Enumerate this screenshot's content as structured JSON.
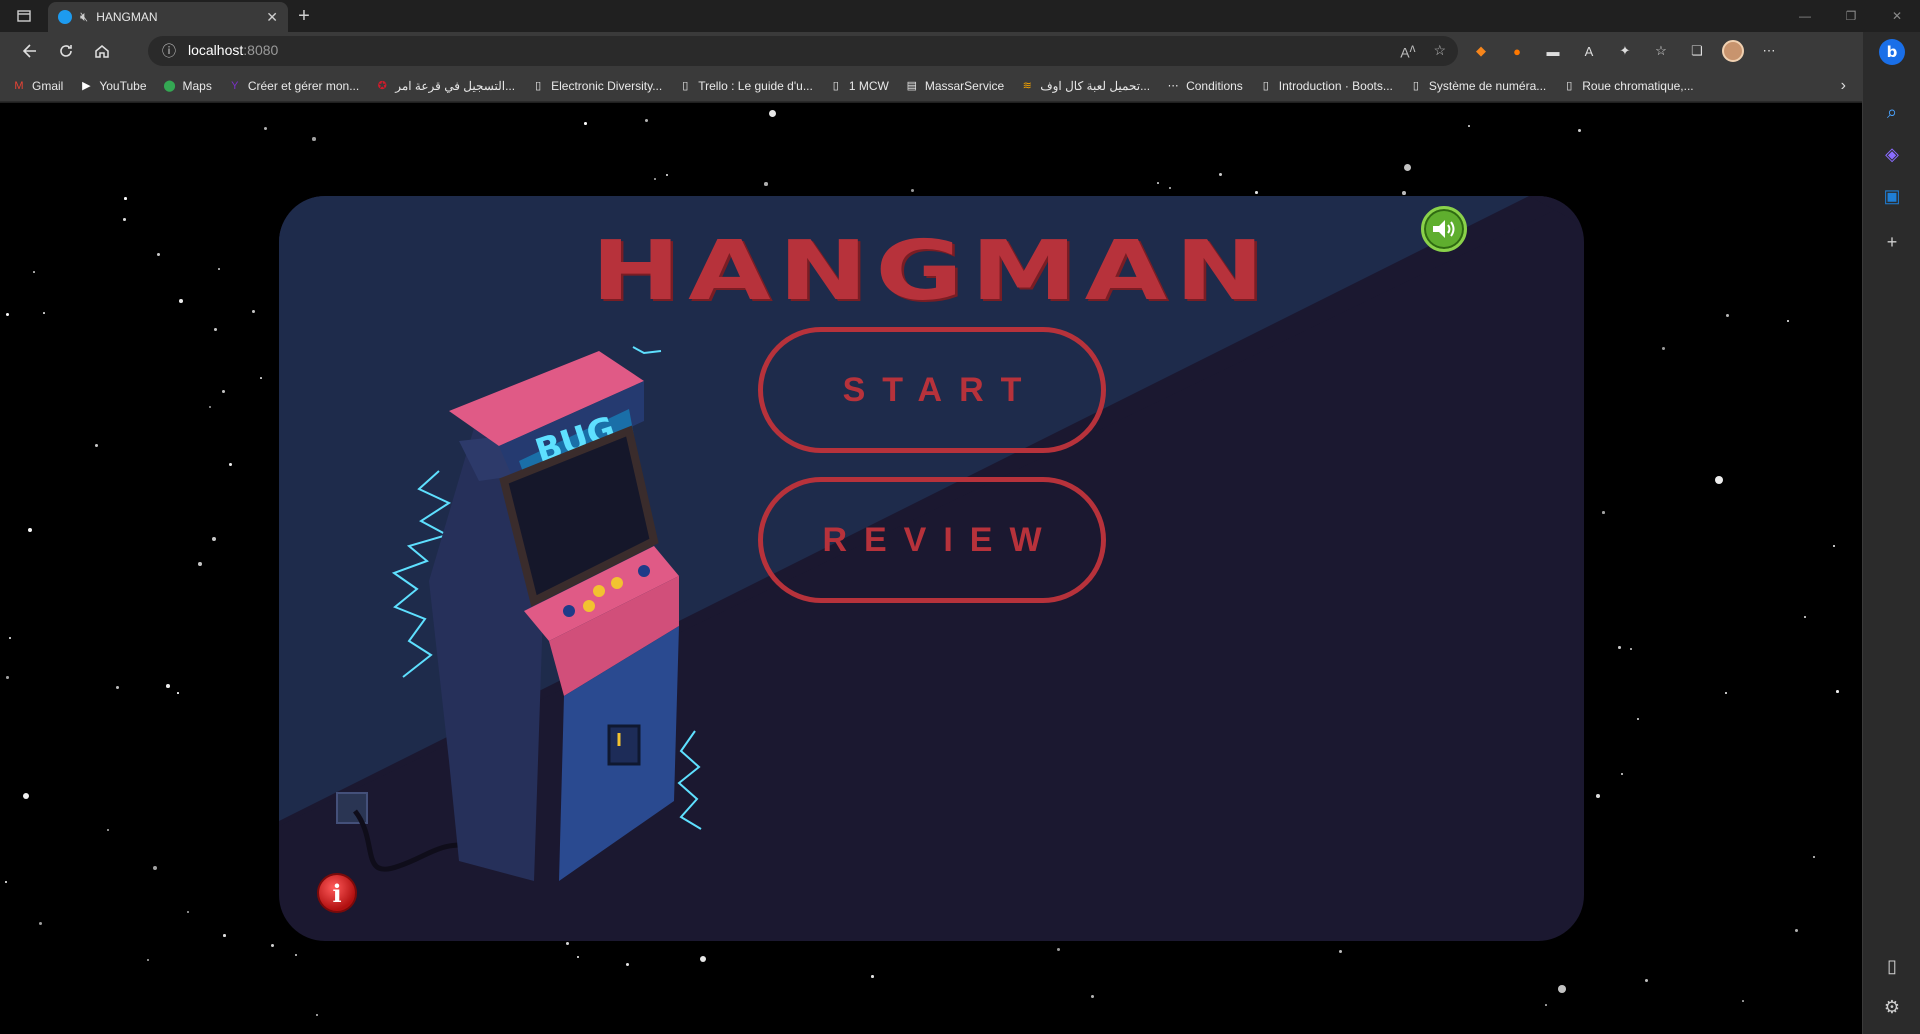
{
  "browser": {
    "tab": {
      "title": "HANGMAN"
    },
    "address": {
      "host": "localhost",
      "port": ":8080"
    },
    "bookmarks": [
      {
        "label": "Gmail",
        "icon": "gmail-icon"
      },
      {
        "label": "YouTube",
        "icon": "youtube-icon"
      },
      {
        "label": "Maps",
        "icon": "maps-icon"
      },
      {
        "label": "Créer et gérer mon...",
        "icon": "yahoo-icon"
      },
      {
        "label": "التسجيل في قرعة امر...",
        "icon": "site-icon"
      },
      {
        "label": "Electronic Diversity...",
        "icon": "page-icon"
      },
      {
        "label": "Trello : Le guide d'u...",
        "icon": "page-icon"
      },
      {
        "label": "1 MCW",
        "icon": "page-icon"
      },
      {
        "label": "MassarService",
        "icon": "site-icon"
      },
      {
        "label": "تحميل لعبة كال اوف...",
        "icon": "site-icon"
      },
      {
        "label": "Conditions",
        "icon": "dots-icon"
      },
      {
        "label": "Introduction · Boots...",
        "icon": "page-icon"
      },
      {
        "label": "Système de numéra...",
        "icon": "page-icon"
      },
      {
        "label": "Roue chromatique,...",
        "icon": "page-icon"
      }
    ]
  },
  "game": {
    "title": "HANGMAN",
    "start_label": "START",
    "review_label": "REVIEW",
    "arcade_marquee": "BUG",
    "info_label": "i",
    "colors": {
      "accent": "#b7323b",
      "card_top": "#1e2a4a",
      "card_bottom": "#1b1830",
      "sound": "#5fae2e"
    }
  }
}
